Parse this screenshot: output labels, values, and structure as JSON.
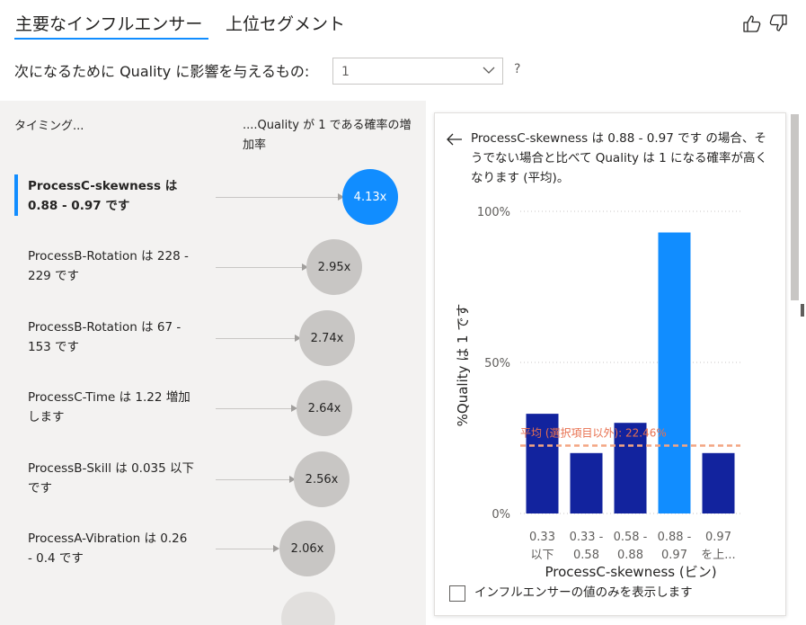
{
  "tabs": {
    "influencers": "主要なインフルエンサー",
    "segments": "上位セグメント"
  },
  "question": {
    "label": "次になるために Quality に影響を与えるもの:",
    "selected_value": "1",
    "help": "?"
  },
  "list": {
    "header_left": "タイミング...",
    "header_right": "....Quality が 1 である確率の増加率",
    "items": [
      {
        "label": "ProcessC-skewness は 0.88 - 0.97 です",
        "value": "4.13x",
        "selected": true
      },
      {
        "label": "ProcessB-Rotation は 228 - 229 です",
        "value": "2.95x",
        "selected": false
      },
      {
        "label": "ProcessB-Rotation は 67 - 153 です",
        "value": "2.74x",
        "selected": false
      },
      {
        "label": "ProcessC-Time は 1.22 増加します",
        "value": "2.64x",
        "selected": false
      },
      {
        "label": "ProcessB-Skill は 0.035 以下です",
        "value": "2.56x",
        "selected": false
      },
      {
        "label": "ProcessA-Vibration は 0.26 - 0.4 です",
        "value": "2.06x",
        "selected": false
      }
    ]
  },
  "detail": {
    "description": "ProcessC-skewness は 0.88 - 0.97 です の場合、そうでない場合と比べて Quality は 1 になる確率が高くなります (平均)。",
    "checkbox_label": "インフルエンサーの値のみを表示します"
  },
  "colors": {
    "accent": "#118dff",
    "bar_default": "#12239e",
    "bar_selected": "#118dff",
    "avg_line": "#f4a582",
    "avg_text": "#e8704f"
  },
  "chart_data": {
    "type": "bar",
    "categories": [
      [
        "0.33",
        "以下"
      ],
      [
        "0.33 -",
        "0.58"
      ],
      [
        "0.58 -",
        "0.88"
      ],
      [
        "0.88 -",
        "0.97"
      ],
      [
        "0.97",
        "を上..."
      ]
    ],
    "values": [
      33,
      20,
      30,
      93,
      20
    ],
    "highlight_index": 3,
    "average": 22.46,
    "average_label": "平均 (選択項目以外): 22.46%",
    "ylim": [
      0,
      100
    ],
    "yticks": [
      "0%",
      "50%",
      "100%"
    ],
    "ytick_values": [
      0,
      50,
      100
    ],
    "xlabel": "ProcessC-skewness (ビン)",
    "ylabel": "%Quality は 1 です"
  }
}
